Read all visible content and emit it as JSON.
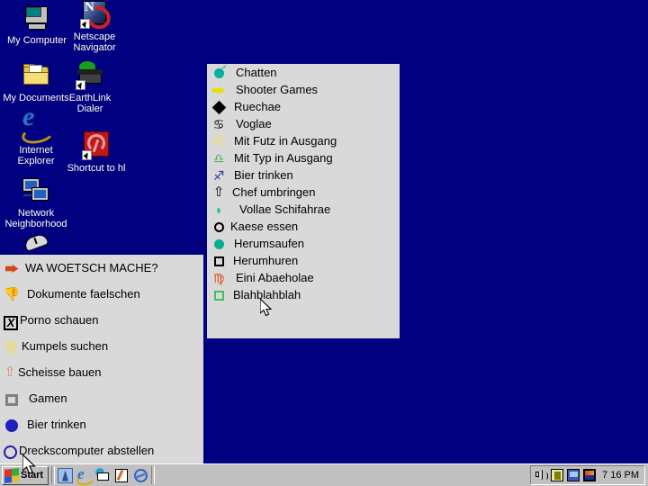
{
  "desktop": {
    "background_color": "#000080",
    "icons": [
      {
        "label": "My Computer",
        "icon": "my-computer-icon"
      },
      {
        "label": "Netscape\nNavigator",
        "label_line1": "Netscape",
        "label_line2": "Navigator",
        "icon": "netscape-navigator-icon"
      },
      {
        "label": "My Documents",
        "icon": "folder-icon"
      },
      {
        "label_line1": "EarthLink",
        "label_line2": "Dialer",
        "label": "EarthLink Dialer",
        "icon": "earthlink-dialer-icon"
      },
      {
        "label_line1": "Internet",
        "label_line2": "Explorer",
        "label": "Internet Explorer",
        "icon": "internet-explorer-icon"
      },
      {
        "label": "Shortcut to hl",
        "icon": "half-life-shortcut-icon"
      },
      {
        "label_line1": "Network",
        "label_line2": "Neighborhood",
        "label": "Network Neighborhood",
        "icon": "network-neighborhood-icon"
      }
    ]
  },
  "menu_right": {
    "background_color": "#d9d9d9",
    "border_color": "#000080",
    "items": [
      {
        "label": "Chatten",
        "icon": "bomb-icon",
        "icon_color": "#00b0a0"
      },
      {
        "label": "Shooter Games",
        "icon": "pointing-hand-icon",
        "icon_color": "#e8e000"
      },
      {
        "label": "Ruechae",
        "icon": "diamond-icon",
        "icon_color": "#000000"
      },
      {
        "label": "Voglae",
        "icon": "cancer-zodiac-icon",
        "icon_color": "#000000"
      },
      {
        "label": "Mit Futz in Ausgang",
        "icon": "leo-zodiac-icon",
        "icon_color": "#f0e040"
      },
      {
        "label": "Mit Typ in Ausgang",
        "icon": "libra-zodiac-icon",
        "icon_color": "#40b060"
      },
      {
        "label": "Bier trinken",
        "icon": "sagittarius-zodiac-icon",
        "icon_color": "#3030a0"
      },
      {
        "label": "Chef umbringen",
        "icon": "up-arrow-icon",
        "icon_color": "#000000"
      },
      {
        "label": "Vollae Schifahrae",
        "icon": "small-dot-icon",
        "icon_color": "#40c080"
      },
      {
        "label": "Kaese essen",
        "icon": "ring-icon",
        "icon_color": "#000000"
      },
      {
        "label": "Herumsaufen",
        "icon": "filled-circle-icon",
        "icon_color": "#00b090"
      },
      {
        "label": "Herumhuren",
        "icon": "square-outline-icon",
        "icon_color": "#000000"
      },
      {
        "label": "Eini Abaeholae",
        "icon": "virgo-zodiac-icon",
        "icon_color": "#e04818"
      },
      {
        "label": "Blahblahblah",
        "icon": "green-square-icon",
        "icon_color": "#40c060"
      }
    ]
  },
  "menu_left": {
    "background_color": "#d9d9d9",
    "border_color": "#000080",
    "items": [
      {
        "label": "WA WOETSCH MACHE?",
        "icon": "pointing-hand-icon",
        "icon_color": "#d04818"
      },
      {
        "label": "Dokumente faelschen",
        "icon": "thumbs-down-icon",
        "icon_color": "#30b090"
      },
      {
        "label": "Porno schauen",
        "icon": "x-box-icon",
        "icon_color": "#000000"
      },
      {
        "label": "Kumpels suchen",
        "icon": "virgo-zodiac-icon",
        "icon_color": "#f0e040"
      },
      {
        "label": "Scheisse bauen",
        "icon": "up-arrow-icon",
        "icon_color": "#e08070"
      },
      {
        "label": "Gamen",
        "icon": "gray-square-icon",
        "icon_color": "#808080"
      },
      {
        "label": "Bier trinken",
        "icon": "blue-circle-icon",
        "icon_color": "#2020c0"
      },
      {
        "label": "Dreckscomputer abstellen",
        "icon": "blue-ring-icon",
        "icon_color": "#2020a0"
      }
    ]
  },
  "taskbar": {
    "start_label": "Start",
    "quick_launch": [
      {
        "name": "show-desktop-icon"
      },
      {
        "name": "internet-explorer-icon"
      },
      {
        "name": "outlook-mail-icon"
      },
      {
        "name": "notepad-edit-icon"
      },
      {
        "name": "channels-icon"
      }
    ],
    "tray_icons": [
      {
        "name": "volume-icon"
      },
      {
        "name": "display-card-icon"
      },
      {
        "name": "monitor-icon"
      },
      {
        "name": "image-icon"
      }
    ],
    "clock": "7 16 PM"
  }
}
